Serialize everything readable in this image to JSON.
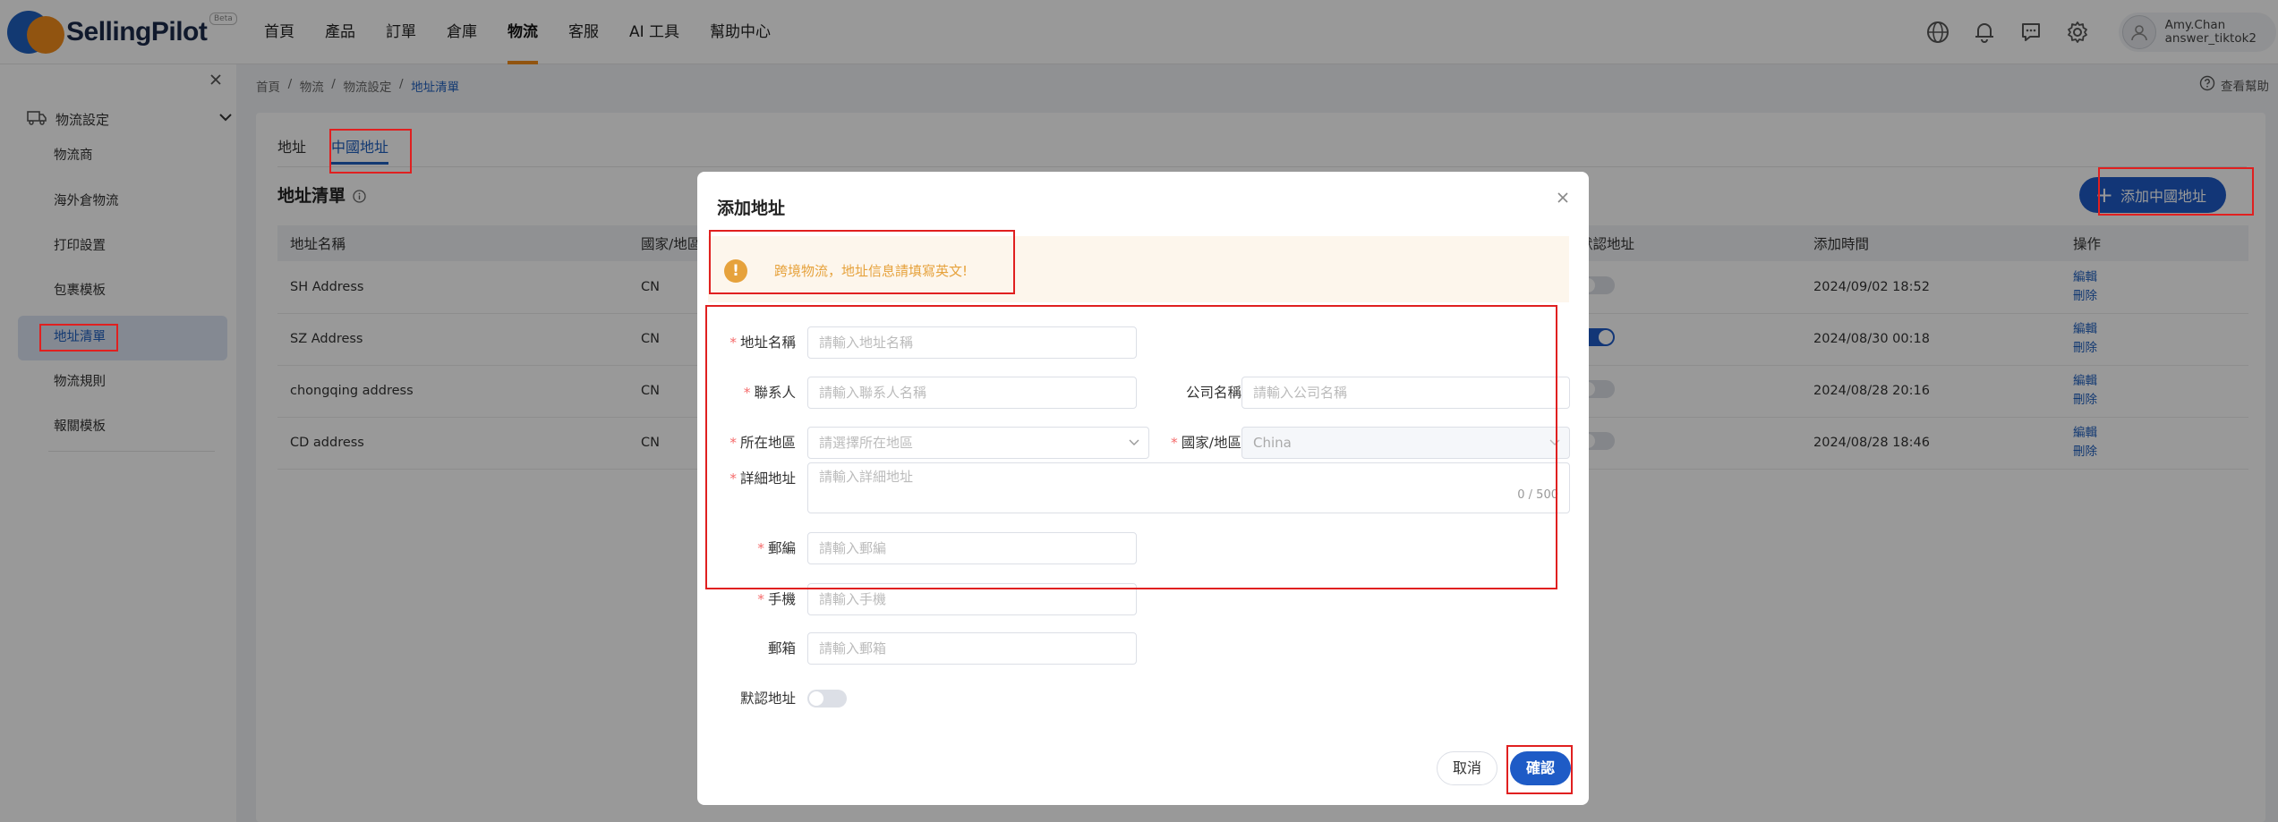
{
  "header": {
    "logo_text": "SellingPilot",
    "logo_badge": "Beta",
    "nav": [
      "首頁",
      "產品",
      "訂單",
      "倉庫",
      "物流",
      "客服",
      "AI 工具",
      "幫助中心"
    ],
    "active_nav": "物流",
    "user_name": "Amy.Chan",
    "user_account": "answer_tiktok2"
  },
  "sidebar": {
    "group_label": "物流設定",
    "items": [
      "物流商",
      "海外倉物流",
      "打印設置",
      "包裹模板",
      "地址清單",
      "物流規則",
      "報關模板"
    ],
    "active_item": "地址清單"
  },
  "breadcrumb": [
    "首頁",
    "物流",
    "物流設定",
    "地址清單"
  ],
  "help_label": "查看幫助",
  "tabs": [
    "地址",
    "中國地址"
  ],
  "active_tab": "中國地址",
  "section_title": "地址清單",
  "add_button_label": "添加中國地址",
  "table": {
    "columns": [
      "地址名稱",
      "國家/地區",
      "默認地址",
      "添加時間",
      "操作"
    ],
    "rows": [
      {
        "name": "SH Address",
        "country": "CN",
        "default": false,
        "added": "2024/09/02 18:52",
        "edit": "編輯",
        "delete": "刪除"
      },
      {
        "name": "SZ Address",
        "country": "CN",
        "default": true,
        "added": "2024/08/30 00:18",
        "edit": "編輯",
        "delete": "刪除"
      },
      {
        "name": "chongqing address",
        "country": "CN",
        "default": false,
        "added": "2024/08/28 20:16",
        "edit": "編輯",
        "delete": "刪除"
      },
      {
        "name": "CD address",
        "country": "CN",
        "default": false,
        "added": "2024/08/28 18:46",
        "edit": "編輯",
        "delete": "刪除"
      }
    ]
  },
  "modal": {
    "title": "添加地址",
    "warning": "跨境物流，地址信息請填寫英文!",
    "fields": {
      "address_name": {
        "label": "地址名稱",
        "placeholder": "請輸入地址名稱",
        "required": true
      },
      "contact": {
        "label": "聯系人",
        "placeholder": "請輸入聯系人名稱",
        "required": true
      },
      "company": {
        "label": "公司名稱",
        "placeholder": "請輸入公司名稱",
        "required": false
      },
      "region": {
        "label": "所在地區",
        "placeholder": "請選擇所在地區",
        "required": true
      },
      "country": {
        "label": "國家/地區",
        "value": "China",
        "required": true
      },
      "detail": {
        "label": "詳細地址",
        "placeholder": "請輸入詳細地址",
        "counter": "0 / 500",
        "required": true
      },
      "postcode": {
        "label": "郵編",
        "placeholder": "請輸入郵編",
        "required": true
      },
      "phone": {
        "label": "手機",
        "placeholder": "請輸入手機",
        "required": true
      },
      "email": {
        "label": "郵箱",
        "placeholder": "請輸入郵箱",
        "required": false
      },
      "default_address": {
        "label": "默認地址",
        "value": false
      }
    },
    "cancel_label": "取消",
    "confirm_label": "確認"
  },
  "colors": {
    "primary": "#1e5bc6",
    "accent": "#f28c1c",
    "warning": "#e6a23c",
    "annotation": "#e02020"
  }
}
